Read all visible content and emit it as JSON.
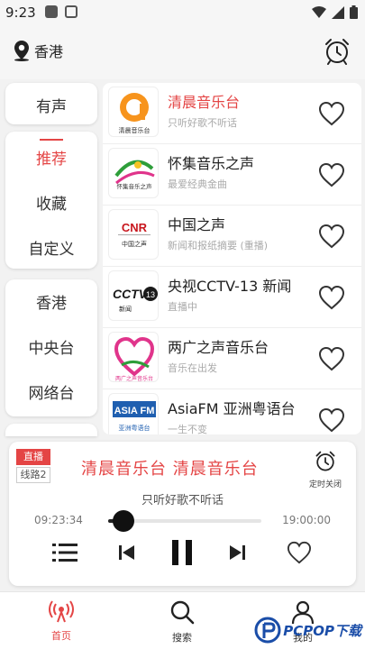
{
  "status_bar": {
    "time": "9:23"
  },
  "header": {
    "location": "香港"
  },
  "sidebar": {
    "top": "有声",
    "group1": [
      "推荐",
      "收藏",
      "自定义"
    ],
    "group2": [
      "香港",
      "中央台",
      "网络台"
    ]
  },
  "stations": [
    {
      "name": "清晨音乐台",
      "desc": "只听好歌不听话",
      "logo_text": "清晨音乐台",
      "active": true
    },
    {
      "name": "怀集音乐之声",
      "desc": "最爱经典金曲",
      "logo_text": "怀集音乐之声"
    },
    {
      "name": "中国之声",
      "desc": "新闻和报纸摘要 (重播)",
      "logo_text": "CNR 中国之声"
    },
    {
      "name": "央视CCTV-13 新闻",
      "desc": "直播中",
      "logo_text": "CCTV 13 新闻"
    },
    {
      "name": "两广之声音乐台",
      "desc": "音乐在出发",
      "logo_text": "两广之声音乐台"
    },
    {
      "name": "AsiaFM 亚洲粤语台",
      "desc": "一生不变",
      "logo_text": "ASIA FM 亚洲粤语台"
    }
  ],
  "player": {
    "live": "直播",
    "line": "线路2",
    "title": "清晨音乐台  清晨音乐台",
    "subtitle": "只听好歌不听话",
    "timer_label": "定时关闭",
    "time_start": "09:23:34",
    "time_end": "19:00:00",
    "progress": 0.1
  },
  "nav": {
    "home": "首页",
    "search": "搜索",
    "profile": "我的"
  },
  "watermark": "PCPOP下载",
  "colors": {
    "accent": "#e44545",
    "text": "#222222",
    "muted": "#aaaaaa"
  }
}
